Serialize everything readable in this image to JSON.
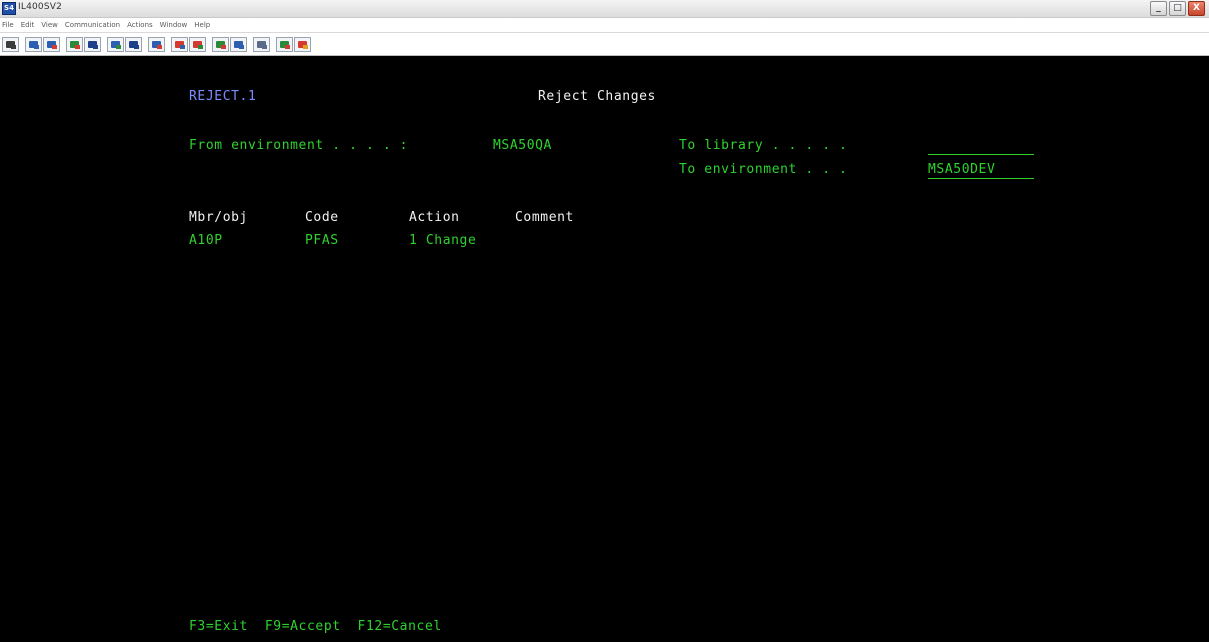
{
  "window": {
    "title": "IL400SV2",
    "app_icon_label": "S4",
    "controls": {
      "minimize": "_",
      "maximize": "□",
      "close": "X"
    }
  },
  "menubar": {
    "items": [
      "File",
      "Edit",
      "View",
      "Communication",
      "Actions",
      "Window",
      "Help"
    ]
  },
  "toolbar": {
    "buttons": [
      "print-screen",
      "copy-paste",
      "send",
      "receive",
      "macro-record",
      "macro-play",
      "display",
      "keypad",
      "edit-copy",
      "edit-paste",
      "transfer",
      "settings",
      "support",
      "help"
    ]
  },
  "screen": {
    "program_id": "REJECT.1",
    "title": "Reject Changes",
    "from_environment_label": "From environment . . . . :",
    "from_environment_value": "MSA50QA",
    "to_library_label": "To library . . . . .",
    "to_library_value": "",
    "to_environment_label": "To environment . . .",
    "to_environment_value": "MSA50DEV",
    "table": {
      "headers": {
        "mbr": "Mbr/obj",
        "code": "Code",
        "action": "Action",
        "comment": "Comment"
      },
      "rows": [
        {
          "mbr": "A10P",
          "code": "PFAS",
          "action": "1 Change",
          "comment": ""
        }
      ]
    },
    "function_keys": "F3=Exit  F9=Accept  F12=Cancel"
  },
  "colors": {
    "background": "#000000",
    "field_text": "#2fd22f",
    "title_text": "#7f8cff",
    "heading_text": "#f2f2f2"
  }
}
